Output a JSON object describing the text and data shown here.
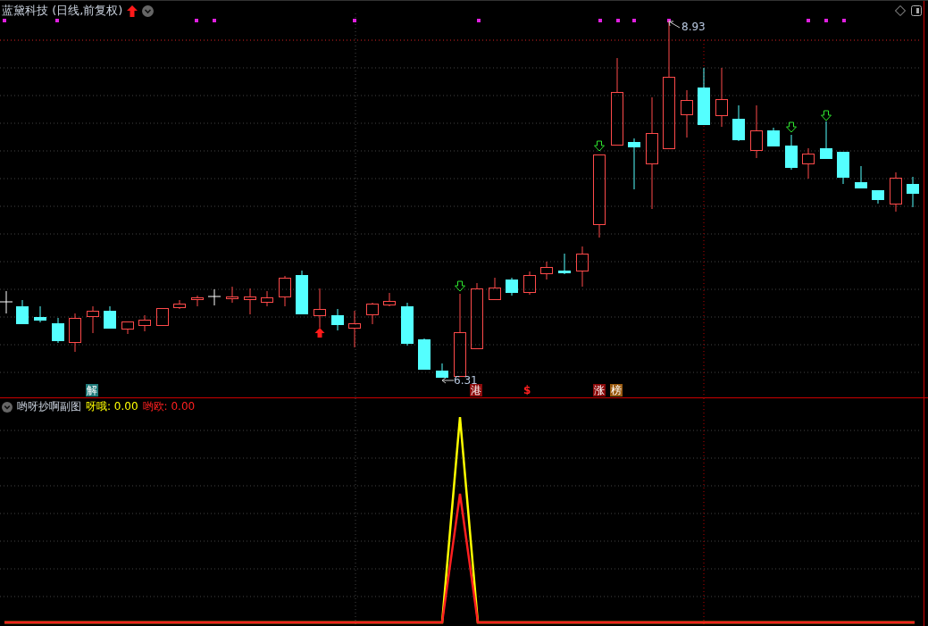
{
  "header": {
    "stock": "蓝黛科技",
    "period": "(日线,前复权)"
  },
  "chart_labels": {
    "high": "8.93",
    "low": "6.31"
  },
  "event_markers": [
    {
      "label": "解",
      "kind": "tag",
      "color": "#1f7a7a"
    },
    {
      "label": "港",
      "kind": "tag",
      "color": "#8b0a0a"
    },
    {
      "label": "$",
      "kind": "plain",
      "color": "#ff2020"
    },
    {
      "label": "涨",
      "kind": "tag",
      "color": "#8b0a0a"
    },
    {
      "label": "榜",
      "kind": "tag",
      "color": "#9a5a10"
    }
  ],
  "indicator": {
    "name": "哟呀抄啊副图",
    "legend": [
      {
        "text": "呀哦: 0.00",
        "color": "#ffff00"
      },
      {
        "text": "哟欧: 0.00",
        "color": "#ff2020"
      }
    ]
  }
}
